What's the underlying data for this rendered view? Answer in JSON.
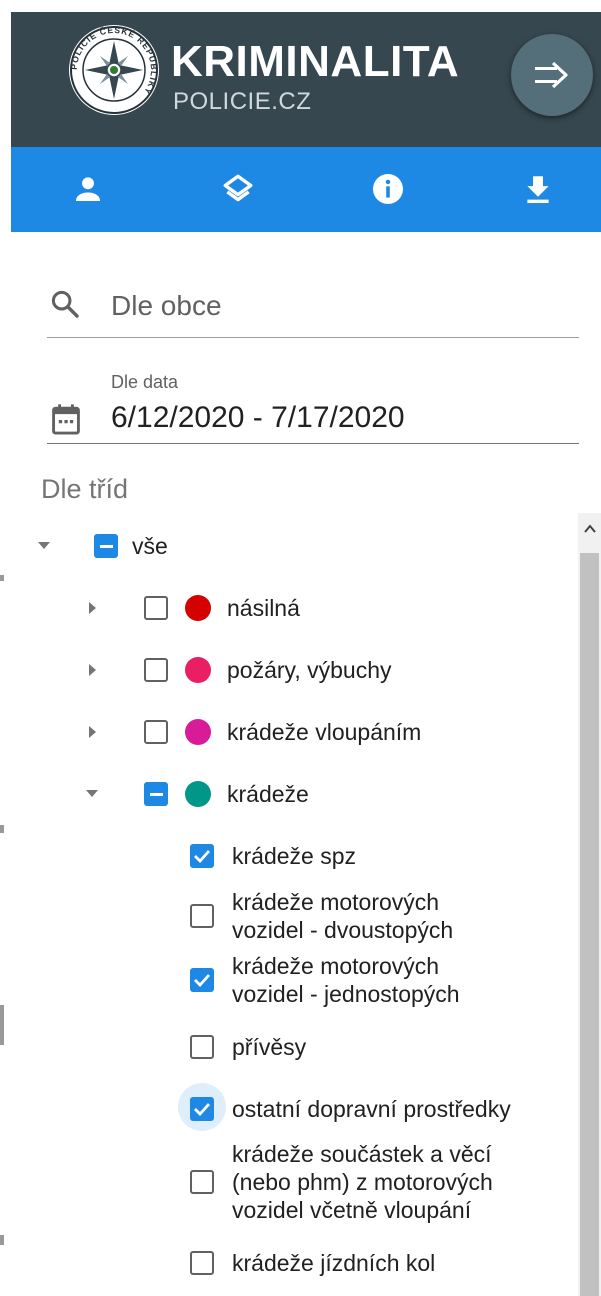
{
  "header": {
    "brand_title": "KRIMINALITA",
    "brand_subtitle": "POLICIE.CZ",
    "logo_ring_text": "POLICIE ČESKÉ REPUBLIKY",
    "menu_icon": "collapse-right-arrow-icon",
    "background": "#37474f"
  },
  "toolbar": {
    "background": "#1e88e5",
    "buttons": [
      {
        "icon": "person-icon"
      },
      {
        "icon": "layers-icon"
      },
      {
        "icon": "info-icon"
      },
      {
        "icon": "download-icon"
      }
    ]
  },
  "filters": {
    "search": {
      "placeholder": "Dle obce",
      "icon": "search-icon"
    },
    "date": {
      "label": "Dle data",
      "value": "6/12/2020 - 7/17/2020",
      "icon": "calendar-icon"
    },
    "classes_title": "Dle tříd"
  },
  "tree": {
    "root": {
      "label": "vše",
      "state": "indeterminate",
      "expanded": true
    },
    "categories": [
      {
        "label": "násilná",
        "color": "#d50000",
        "state": "unchecked",
        "expanded": false
      },
      {
        "label": "požáry, výbuchy",
        "color": "#e91e63",
        "state": "unchecked",
        "expanded": false
      },
      {
        "label": "krádeže vloupáním",
        "color": "#d81b99",
        "state": "unchecked",
        "expanded": false
      },
      {
        "label": "krádeže",
        "color": "#009688",
        "state": "indeterminate",
        "expanded": true
      }
    ],
    "children": [
      {
        "lines": [
          "krádeže spz"
        ],
        "state": "checked"
      },
      {
        "lines": [
          "krádeže motorových",
          "vozidel - dvoustopých"
        ],
        "state": "unchecked"
      },
      {
        "lines": [
          "krádeže motorových",
          "vozidel - jednostopých"
        ],
        "state": "checked"
      },
      {
        "lines": [
          "přívěsy"
        ],
        "state": "unchecked"
      },
      {
        "lines": [
          "ostatní dopravní prostředky"
        ],
        "state": "checked",
        "focused": true
      },
      {
        "lines": [
          "krádeže součástek a věcí",
          "(nebo phm) z motorových",
          "vozidel včetně vloupání"
        ],
        "state": "unchecked"
      },
      {
        "lines": [
          "krádeže jízdních kol"
        ],
        "state": "unchecked"
      }
    ]
  },
  "accent": "#1e88e5"
}
